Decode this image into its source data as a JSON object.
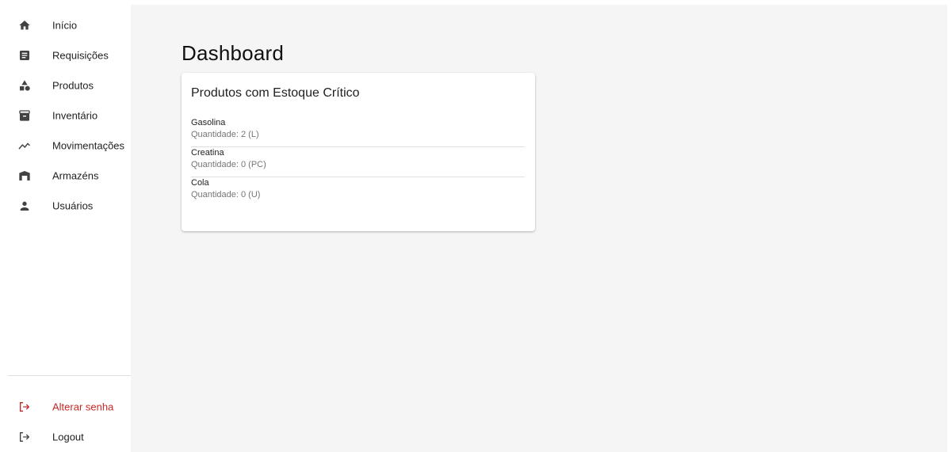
{
  "sidebar": {
    "items": [
      {
        "label": "Início",
        "icon": "home-icon"
      },
      {
        "label": "Requisições",
        "icon": "document-icon"
      },
      {
        "label": "Produtos",
        "icon": "category-icon"
      },
      {
        "label": "Inventário",
        "icon": "archive-icon"
      },
      {
        "label": "Movimentações",
        "icon": "trend-line-icon"
      },
      {
        "label": "Armazéns",
        "icon": "warehouse-icon"
      },
      {
        "label": "Usuários",
        "icon": "person-icon"
      }
    ],
    "footer": [
      {
        "label": "Alterar senha",
        "icon": "logout-arrow-icon",
        "color": "#c62828"
      },
      {
        "label": "Logout",
        "icon": "logout-arrow-icon"
      }
    ]
  },
  "main": {
    "title": "Dashboard",
    "card": {
      "title": "Produtos com Estoque Crítico",
      "items": [
        {
          "name": "Gasolina",
          "quantity": "Quantidade: 2 (L)"
        },
        {
          "name": "Creatina",
          "quantity": "Quantidade: 0 (PC)"
        },
        {
          "name": "Cola",
          "quantity": "Quantidade: 0 (U)"
        }
      ]
    }
  },
  "colors": {
    "background": "#f5f5f5",
    "icon": "#424242",
    "danger": "#c62828"
  }
}
